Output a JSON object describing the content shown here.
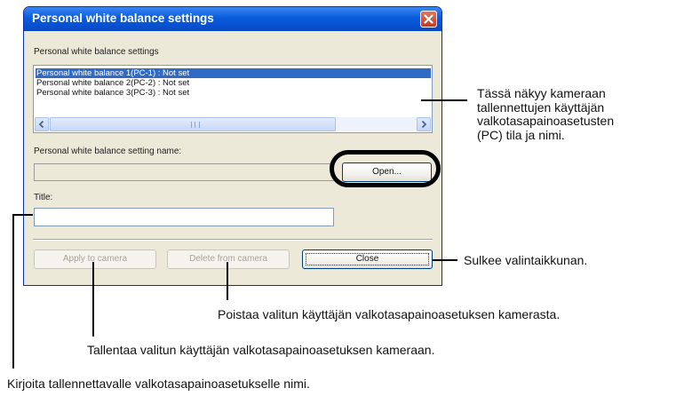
{
  "dialog": {
    "title": "Personal white balance settings",
    "list_group_label": "Personal white balance settings",
    "list_items": [
      "Personal white balance 1(PC-1) : Not set",
      "Personal white balance 2(PC-2) : Not set",
      "Personal white balance 3(PC-3) : Not set"
    ],
    "selected_index": 0,
    "setting_name_label": "Personal white balance setting name:",
    "setting_name_value": "",
    "open_label": "Open...",
    "title_label": "Title:",
    "title_value": "",
    "apply_label": "Apply to camera",
    "delete_label": "Delete from camera",
    "close_label": "Close"
  },
  "annotations": {
    "list_info": [
      "Tässä näkyy kameraan",
      "tallennettujen käyttäjän",
      "valkotasapainoasetusten",
      "(PC) tila ja nimi."
    ],
    "close_info": "Sulkee valintaikkunan.",
    "delete_info": "Poistaa valitun käyttäjän valkotasapainoasetuksen kamerasta.",
    "apply_info": "Tallentaa valitun käyttäjän valkotasapainoasetuksen kameraan.",
    "title_info": "Kirjoita tallennettavalle valkotasapainoasetukselle nimi."
  }
}
